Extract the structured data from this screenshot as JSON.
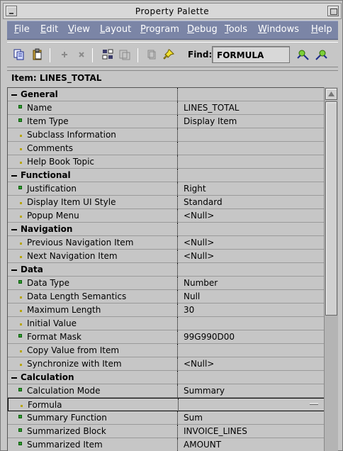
{
  "window": {
    "title": "Property Palette"
  },
  "menu": [
    {
      "label": "File",
      "key": "F",
      "rest": "ile"
    },
    {
      "label": "Edit",
      "key": "E",
      "rest": "dit"
    },
    {
      "label": "View",
      "key": "V",
      "rest": "iew"
    },
    {
      "label": "Layout",
      "key": "L",
      "rest": "ayout"
    },
    {
      "label": "Program",
      "key": "P",
      "rest": "rogram"
    },
    {
      "label": "Debug",
      "key": "D",
      "rest": "ebug"
    },
    {
      "label": "Tools",
      "key": "T",
      "rest": "ools"
    },
    {
      "label": "Windows",
      "key": "W",
      "rest": "indows"
    },
    {
      "label": "Help",
      "key": "H",
      "rest": "elp"
    }
  ],
  "toolbar": {
    "find_label": "Find:",
    "find_value": "FORMULA"
  },
  "item_header": "Item: LINES_TOTAL",
  "rows": [
    {
      "kind": "cat",
      "name": "General",
      "value": ""
    },
    {
      "kind": "prop",
      "state": "modified",
      "name": "Name",
      "value": "LINES_TOTAL"
    },
    {
      "kind": "prop",
      "state": "modified",
      "name": "Item Type",
      "value": "Display Item"
    },
    {
      "kind": "prop",
      "state": "default",
      "name": "Subclass Information",
      "value": ""
    },
    {
      "kind": "prop",
      "state": "default",
      "name": "Comments",
      "value": ""
    },
    {
      "kind": "prop",
      "state": "default",
      "name": "Help Book Topic",
      "value": ""
    },
    {
      "kind": "cat",
      "name": "Functional",
      "value": ""
    },
    {
      "kind": "prop",
      "state": "modified",
      "name": "Justification",
      "value": "Right"
    },
    {
      "kind": "prop",
      "state": "default",
      "name": "Display Item UI Style",
      "value": "Standard"
    },
    {
      "kind": "prop",
      "state": "default",
      "name": "Popup Menu",
      "value": "<Null>"
    },
    {
      "kind": "cat",
      "name": "Navigation",
      "value": ""
    },
    {
      "kind": "prop",
      "state": "default",
      "name": "Previous Navigation Item",
      "value": "<Null>"
    },
    {
      "kind": "prop",
      "state": "default",
      "name": "Next Navigation Item",
      "value": "<Null>"
    },
    {
      "kind": "cat",
      "name": "Data",
      "value": ""
    },
    {
      "kind": "prop",
      "state": "modified",
      "name": "Data Type",
      "value": "Number"
    },
    {
      "kind": "prop",
      "state": "default",
      "name": "Data Length Semantics",
      "value": "Null"
    },
    {
      "kind": "prop",
      "state": "default",
      "name": "Maximum Length",
      "value": "30"
    },
    {
      "kind": "prop",
      "state": "default",
      "name": "Initial Value",
      "value": ""
    },
    {
      "kind": "prop",
      "state": "modified",
      "name": "Format Mask",
      "value": "99G990D00"
    },
    {
      "kind": "prop",
      "state": "default",
      "name": "Copy Value from Item",
      "value": ""
    },
    {
      "kind": "prop",
      "state": "default",
      "name": "Synchronize with Item",
      "value": "<Null>"
    },
    {
      "kind": "cat",
      "name": "Calculation",
      "value": ""
    },
    {
      "kind": "prop",
      "state": "modified",
      "name": "Calculation Mode",
      "value": "Summary"
    },
    {
      "kind": "prop",
      "state": "default",
      "name": "Formula",
      "value": "",
      "selected": true
    },
    {
      "kind": "prop",
      "state": "modified",
      "name": "Summary Function",
      "value": "Sum"
    },
    {
      "kind": "prop",
      "state": "modified",
      "name": "Summarized Block",
      "value": "INVOICE_LINES"
    },
    {
      "kind": "prop",
      "state": "modified",
      "name": "Summarized Item",
      "value": "AMOUNT"
    }
  ]
}
